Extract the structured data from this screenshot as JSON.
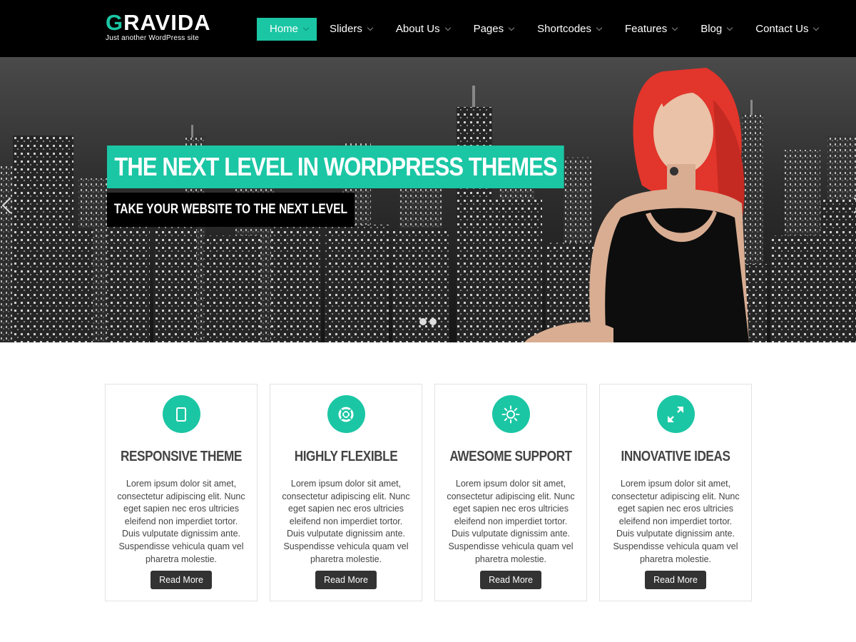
{
  "site": {
    "title_first": "G",
    "title_rest": "RAVIDA",
    "tagline": "Just another WordPress site"
  },
  "nav": {
    "items": [
      {
        "label": "Home"
      },
      {
        "label": "Sliders"
      },
      {
        "label": "About Us"
      },
      {
        "label": "Pages"
      },
      {
        "label": "Shortcodes"
      },
      {
        "label": "Features"
      },
      {
        "label": "Blog"
      },
      {
        "label": "Contact Us"
      }
    ]
  },
  "hero": {
    "title": "THE NEXT LEVEL IN WORDPRESS THEMES",
    "subtitle": "TAKE YOUR WEBSITE TO THE NEXT LEVEL"
  },
  "features": [
    {
      "icon": "tablet-icon",
      "title": "RESPONSIVE THEME",
      "text": "Lorem ipsum dolor sit amet, consectetur adipiscing elit. Nunc eget sapien nec eros ultricies eleifend non imperdiet tortor. Duis vulputate dignissim ante. Suspendisse vehicula quam vel pharetra molestie.",
      "button": "Read More"
    },
    {
      "icon": "lifebuoy-icon",
      "title": "HIGHLY FLEXIBLE",
      "text": "Lorem ipsum dolor sit amet, consectetur adipiscing elit. Nunc eget sapien nec eros ultricies eleifend non imperdiet tortor. Duis vulputate dignissim ante. Suspendisse vehicula quam vel pharetra molestie.",
      "button": "Read More"
    },
    {
      "icon": "sun-icon",
      "title": "AWESOME SUPPORT",
      "text": "Lorem ipsum dolor sit amet, consectetur adipiscing elit. Nunc eget sapien nec eros ultricies eleifend non imperdiet tortor. Duis vulputate dignissim ante. Suspendisse vehicula quam vel pharetra molestie.",
      "button": "Read More"
    },
    {
      "icon": "expand-arrows-icon",
      "title": "INNOVATIVE IDEAS",
      "text": "Lorem ipsum dolor sit amet, consectetur adipiscing elit. Nunc eget sapien nec eros ultricies eleifend non imperdiet tortor. Duis vulputate dignissim ante. Suspendisse vehicula quam vel pharetra molestie.",
      "button": "Read More"
    }
  ],
  "colors": {
    "accent": "#1bc6a4",
    "header_bg": "#000000",
    "button_bg": "#333333"
  }
}
